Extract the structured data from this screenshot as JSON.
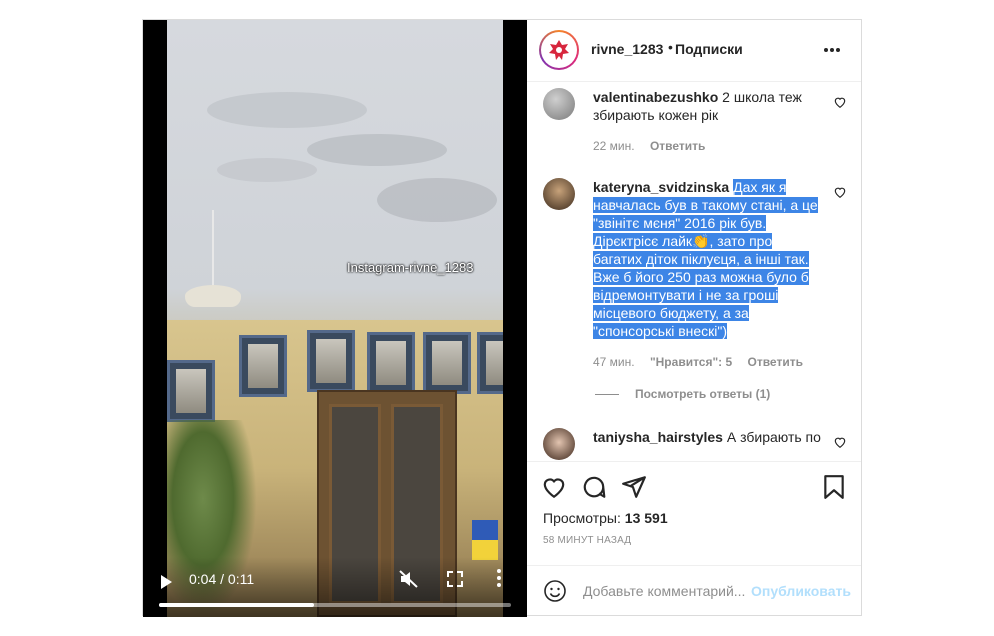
{
  "video": {
    "watermark": "Instagram-rivne_1283",
    "time": "0:04 / 0:11",
    "progress": 0.44,
    "icons": {
      "play": "play-icon",
      "mute": "mute-icon",
      "fullscreen": "fullscreen-icon",
      "more": "more-vertical-icon"
    }
  },
  "header": {
    "username": "rivne_1283",
    "separator": "•",
    "follow_label": "Подписки"
  },
  "comments": [
    {
      "username": "valentinabezushko",
      "text": "2 школа теж збирають кожен рік",
      "time": "22 мин.",
      "reply_label": "Ответить"
    },
    {
      "username": "kateryna_svidzinska",
      "text": "Дах як я навчалась був в такому стані, а це \"звінітє мєня\" 2016 рік був. Дірєктрісє лайк👏, зато про багатих діток піклуєця, а інші так. Вже б його 250 раз можна було б відремонтувати і не за гроші місцевого бюджету, а за \"спонсорські внескі\")",
      "time": "47 мин.",
      "likes_label": "\"Нравится\": 5",
      "reply_label": "Ответить",
      "view_replies": "Посмотреть ответы (1)"
    },
    {
      "username": "taniysha_hairstyles",
      "text": "А збирають по"
    }
  ],
  "views_label": "Просмотры:",
  "views_count": "13 591",
  "posted_ago": "58 МИНУТ НАЗАД",
  "add_comment": {
    "placeholder": "Добавьте комментарий...",
    "publish_label": "Опубликовать"
  },
  "colors": {
    "accent_blue": "#0095f6",
    "publish_disabled": "#b2dffc",
    "selection": "#3d85e6",
    "muted": "#8e8e8e"
  }
}
